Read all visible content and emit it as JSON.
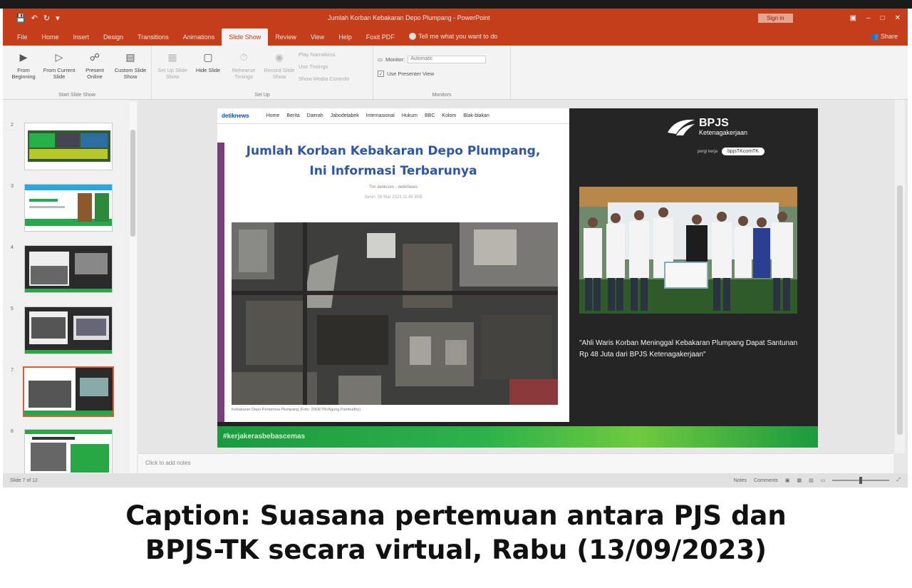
{
  "titlebar": {
    "doc_title": "Jumlah Korban Kebakaran Depo Plumpang - PowerPoint",
    "signin": "Sign in",
    "quick_access": [
      "save-icon",
      "undo-icon",
      "redo-icon",
      "customize-icon"
    ]
  },
  "tabs": [
    "File",
    "Home",
    "Insert",
    "Design",
    "Transitions",
    "Animations",
    "Slide Show",
    "Review",
    "View",
    "Help",
    "Foxit PDF"
  ],
  "active_tab": "Slide Show",
  "tell_me": "Tell me what you want to do",
  "share": "Share",
  "ribbon": {
    "start_group": {
      "label": "Start Slide Show",
      "buttons": [
        {
          "label": "From Beginning",
          "icon": "play-start-icon"
        },
        {
          "label": "From Current Slide",
          "icon": "play-current-icon"
        },
        {
          "label": "Present Online",
          "icon": "present-online-icon"
        },
        {
          "label": "Custom Slide Show",
          "icon": "custom-show-icon"
        }
      ]
    },
    "setup_group": {
      "label": "Set Up",
      "buttons": [
        {
          "label": "Set Up Slide Show",
          "icon": "setup-icon"
        },
        {
          "label": "Hide Slide",
          "icon": "hide-slide-icon"
        },
        {
          "label": "Rehearse Timings",
          "icon": "rehearse-icon"
        },
        {
          "label": "Record Slide Show",
          "icon": "record-icon"
        }
      ],
      "options": [
        "Play Narrations",
        "Use Timings",
        "Show Media Controls"
      ]
    },
    "monitors_group": {
      "label": "Monitors",
      "monitor_label": "Monitor:",
      "monitor_value": "Automatic",
      "presenter_view": "Use Presenter View"
    }
  },
  "thumbnails": [
    "2",
    "3",
    "4",
    "5",
    "7",
    "8"
  ],
  "slide": {
    "article": {
      "site": "detiknews",
      "nav": [
        "Home",
        "Berita",
        "Daerah",
        "Jabodetabek",
        "Internasional",
        "Hukum",
        "BBC",
        "Kolom",
        "Blak-blakan"
      ],
      "title_line1": "Jumlah Korban Kebakaran Depo Plumpang,",
      "title_line2": "Ini Informasi Terbarunya",
      "meta": "Tim detikcom - detikNews",
      "date": "Senin, 06 Mar 2023 11:45 WIB",
      "photo_caption": "Kebakaran Depo Pertamina Plumpang (Foto: 20DETIK/Agung Pambudhy)"
    },
    "bpjs": {
      "name": "BPJS",
      "sub": "Ketenagakerjaan",
      "tagline": "pergi kerja",
      "pill": "bpjsTKcomTK"
    },
    "quote": "\"Ahli Waris Korban Meninggal Kebakaran Plumpang Dapat Santunan Rp 48 Juta dari BPJS Ketenagakerjaan\"",
    "hashtag": "#kerjakerasbebascemas"
  },
  "notes_placeholder": "Click to add notes",
  "status": {
    "slide_info": "Slide 7 of 12",
    "notes_btn": "Notes",
    "comments_btn": "Comments"
  },
  "caption": {
    "line1": "Caption: Suasana pertemuan antara PJS dan",
    "line2": "BPJS-TK secara virtual, Rabu (13/09/2023)"
  },
  "colors": {
    "ppt_accent": "#c43e1c",
    "bpjs_green": "#2db24b",
    "article_title": "#2d56a8"
  }
}
